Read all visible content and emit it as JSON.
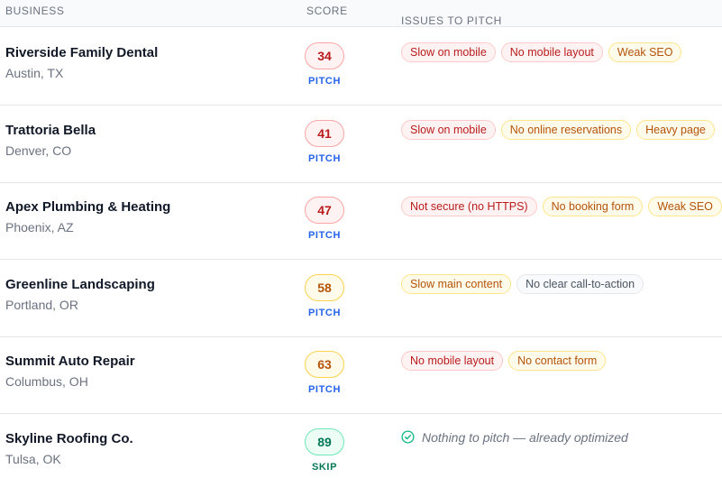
{
  "header": {
    "business": "BUSINESS",
    "score": "SCORE",
    "issues": "ISSUES TO PITCH"
  },
  "colors": {
    "red": "#b91c1c",
    "amber": "#b45309",
    "green": "#047857",
    "pitch_blue": "#2563eb",
    "muted": "#6b7280"
  },
  "rows": [
    {
      "name": "Riverside Family Dental",
      "location": "Austin, TX",
      "score": "34",
      "score_level": "red",
      "verdict": "PITCH",
      "issues": [
        {
          "label": "Slow on mobile",
          "severity": "red"
        },
        {
          "label": "No mobile layout",
          "severity": "red"
        },
        {
          "label": "Weak SEO",
          "severity": "amber"
        }
      ]
    },
    {
      "name": "Trattoria Bella",
      "location": "Denver, CO",
      "score": "41",
      "score_level": "red",
      "verdict": "PITCH",
      "issues": [
        {
          "label": "Slow on mobile",
          "severity": "red"
        },
        {
          "label": "No online reservations",
          "severity": "amber"
        },
        {
          "label": "Heavy page",
          "severity": "amber"
        }
      ]
    },
    {
      "name": "Apex Plumbing & Heating",
      "location": "Phoenix, AZ",
      "score": "47",
      "score_level": "red",
      "verdict": "PITCH",
      "issues": [
        {
          "label": "Not secure (no HTTPS)",
          "severity": "red"
        },
        {
          "label": "No booking form",
          "severity": "amber"
        },
        {
          "label": "Weak SEO",
          "severity": "amber"
        }
      ]
    },
    {
      "name": "Greenline Landscaping",
      "location": "Portland, OR",
      "score": "58",
      "score_level": "amber",
      "verdict": "PITCH",
      "issues": [
        {
          "label": "Slow main content",
          "severity": "amber"
        },
        {
          "label": "No clear call-to-action",
          "severity": "gray"
        }
      ]
    },
    {
      "name": "Summit Auto Repair",
      "location": "Columbus, OH",
      "score": "63",
      "score_level": "amber",
      "verdict": "PITCH",
      "issues": [
        {
          "label": "No mobile layout",
          "severity": "red"
        },
        {
          "label": "No contact form",
          "severity": "amber"
        }
      ]
    },
    {
      "name": "Skyline Roofing Co.",
      "location": "Tulsa, OK",
      "score": "89",
      "score_level": "green",
      "verdict": "SKIP",
      "issues": [],
      "note": "Nothing to pitch — already optimized",
      "note_icon": "check-circle-icon"
    }
  ]
}
